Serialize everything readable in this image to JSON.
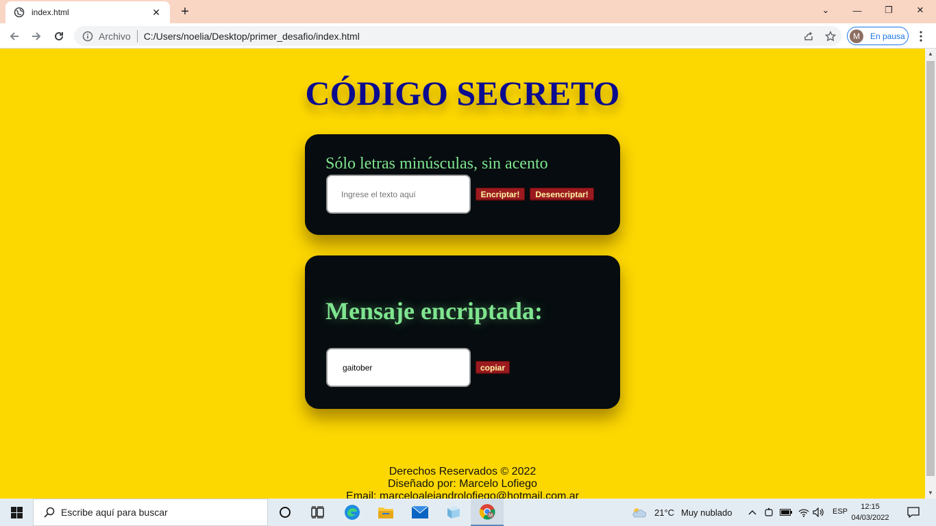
{
  "browser": {
    "tab_title": "index.html",
    "tab_close": "✕",
    "new_tab": "+",
    "origin_label": "Archivo",
    "url": "C:/Users/noelia/Desktop/primer_desafio/index.html",
    "profile_initial": "M",
    "profile_status": "En pausa",
    "window_controls": [
      "⌄",
      "—",
      "❐",
      "✕"
    ]
  },
  "page": {
    "title": "CÓDIGO SECRETO",
    "encrypt_card": {
      "hint": "Sólo letras minúsculas, sin acento",
      "input_placeholder": "Ingrese el texto aquí",
      "encrypt_button": "Encriptar!",
      "decrypt_button": "Desencriptar!"
    },
    "output_card": {
      "title": "Mensaje encriptada:",
      "output_value": "gaitober",
      "copy_button": "copiar"
    },
    "footer": {
      "rights": "Derechos Reservados © 2022",
      "designer": "Diseñado por: Marcelo Lofiego",
      "email": "Email: marceloalejandrolofiego@hotmail.com.ar"
    }
  },
  "taskbar": {
    "search_placeholder": "Escribe aquí para buscar",
    "weather_temp": "21°C",
    "weather_desc": "Muy nublado",
    "language": "ESP",
    "time": "12:15",
    "date": "04/03/2022"
  },
  "colors": {
    "page_background": "#fdd800",
    "title": "#0b0b8f",
    "card_background": "#060c0f",
    "accent_green": "#7fe58f",
    "button_red": "#9b1a1f",
    "button_text": "#fff8a6",
    "tabbar": "#f9d5c4"
  }
}
